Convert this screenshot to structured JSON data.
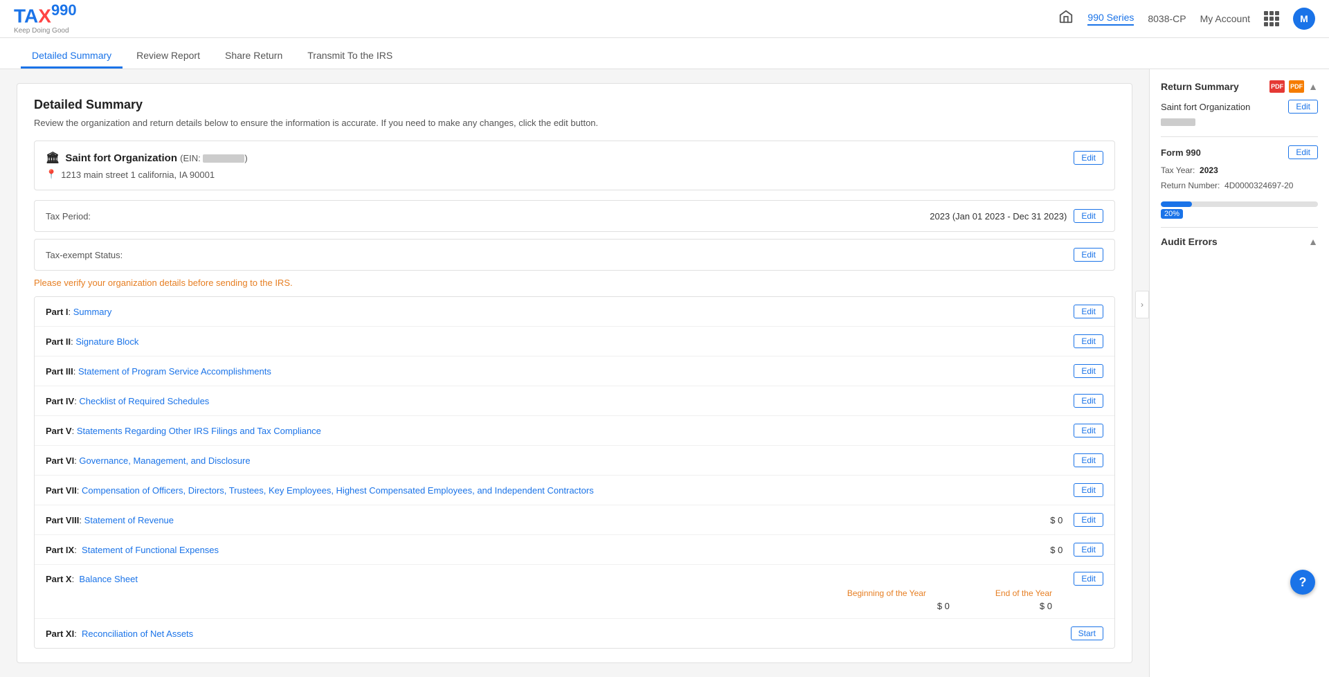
{
  "header": {
    "logo": "TAX990",
    "logo_subtitle": "Keep Doing Good",
    "nav_990": "990 Series",
    "nav_8038": "8038-CP",
    "nav_account": "My Account",
    "avatar_initial": "M"
  },
  "tabs": [
    {
      "id": "detailed-summary",
      "label": "Detailed Summary",
      "active": true
    },
    {
      "id": "review-report",
      "label": "Review Report",
      "active": false
    },
    {
      "id": "share-return",
      "label": "Share Return",
      "active": false
    },
    {
      "id": "transmit-irs",
      "label": "Transmit To the IRS",
      "active": false
    }
  ],
  "page": {
    "title": "Detailed Summary",
    "description": "Review the organization and return details below to ensure the information is accurate. If you need to make any changes, click the edit button.",
    "verify_notice": "Please verify your organization details before sending to the IRS."
  },
  "organization": {
    "name": "Saint fort Organization",
    "ein_label": "EIN:",
    "ein_value": "██ ███████",
    "address": "1213 main street 1 california, IA 90001",
    "tax_period_label": "Tax Period:",
    "tax_period_value": "2023 (Jan 01 2023 - Dec 31 2023)",
    "tax_exempt_label": "Tax-exempt Status:"
  },
  "parts": [
    {
      "id": "part1",
      "label": "Part I",
      "description": "Summary",
      "amount": null,
      "button": "Edit"
    },
    {
      "id": "part2",
      "label": "Part II",
      "description": "Signature Block",
      "amount": null,
      "button": "Edit"
    },
    {
      "id": "part3",
      "label": "Part III",
      "description": "Statement of Program Service Accomplishments",
      "amount": null,
      "button": "Edit"
    },
    {
      "id": "part4",
      "label": "Part IV",
      "description": "Checklist of Required Schedules",
      "amount": null,
      "button": "Edit"
    },
    {
      "id": "part5",
      "label": "Part V",
      "description": "Statements Regarding Other IRS Filings and Tax Compliance",
      "amount": null,
      "button": "Edit"
    },
    {
      "id": "part6",
      "label": "Part VI",
      "description": "Governance, Management, and Disclosure",
      "amount": null,
      "button": "Edit"
    },
    {
      "id": "part7",
      "label": "Part VII",
      "description": "Compensation of Officers, Directors, Trustees, Key Employees, Highest Compensated Employees, and Independent Contractors",
      "amount": null,
      "button": "Edit"
    },
    {
      "id": "part8",
      "label": "Part VIII",
      "description": "Statement of Revenue",
      "amount": "$ 0",
      "button": "Edit"
    },
    {
      "id": "part9",
      "label": "Part IX",
      "description": "Statement of Functional Expenses",
      "amount": "$ 0",
      "button": "Edit"
    },
    {
      "id": "part10",
      "label": "Part X",
      "description": "Balance Sheet",
      "amount": null,
      "button": "Edit",
      "has_balance": true,
      "beginning_label": "Beginning of the Year",
      "end_label": "End of the Year",
      "beginning_amount": "$ 0",
      "end_amount": "$ 0"
    },
    {
      "id": "part11",
      "label": "Part XI",
      "description": "Reconciliation of Net Assets",
      "amount": null,
      "button": "Start"
    }
  ],
  "sidebar": {
    "return_summary_label": "Return Summary",
    "org_name": "Saint fort Organization",
    "form_label": "Form 990",
    "tax_year_label": "Tax Year:",
    "tax_year_value": "2023",
    "return_number_label": "Return Number:",
    "return_number_value": "4D0000324697-20",
    "progress_percent": 20,
    "progress_label": "20%",
    "audit_errors_label": "Audit Errors"
  }
}
